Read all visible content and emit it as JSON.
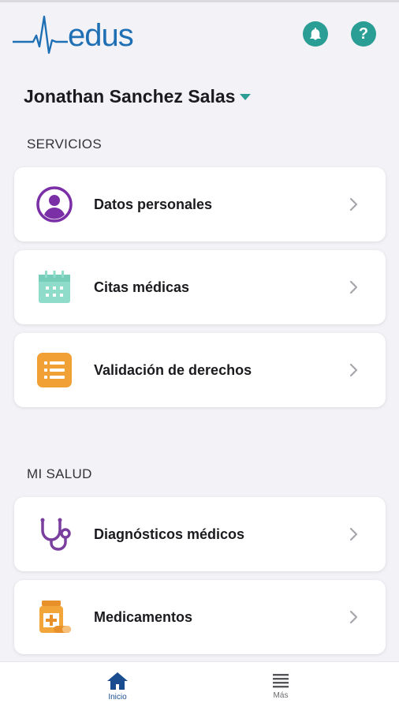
{
  "app": {
    "logo_text": "edus"
  },
  "header": {
    "bell_icon": "bell-icon",
    "help_icon": "help-icon",
    "help_glyph": "?",
    "accent_color": "#2a9d94"
  },
  "user": {
    "name": "Jonathan Sanchez Salas"
  },
  "sections": {
    "servicios": {
      "title": "SERVICIOS",
      "items": [
        {
          "label": "Datos personales",
          "icon": "person-icon"
        },
        {
          "label": "Citas médicas",
          "icon": "calendar-icon"
        },
        {
          "label": "Validación de derechos",
          "icon": "list-icon"
        }
      ]
    },
    "mi_salud": {
      "title": "MI SALUD",
      "items": [
        {
          "label": "Diagnósticos médicos",
          "icon": "stethoscope-icon"
        },
        {
          "label": "Medicamentos",
          "icon": "medicine-icon"
        }
      ]
    }
  },
  "bottom_nav": {
    "home_label": "Inicio",
    "more_label": "Más"
  }
}
